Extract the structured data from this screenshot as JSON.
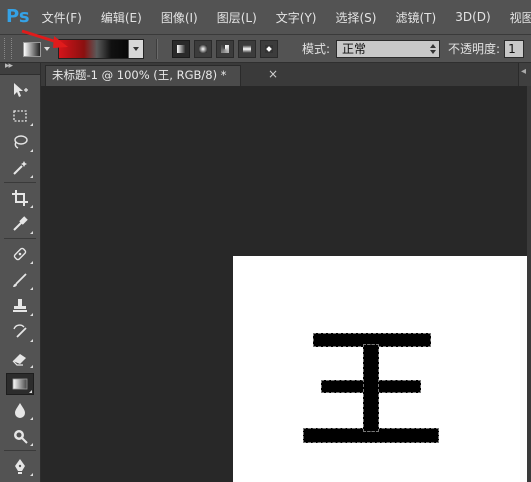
{
  "app": {
    "logo": "Ps"
  },
  "menu": [
    "文件(F)",
    "编辑(E)",
    "图像(I)",
    "图层(L)",
    "文字(Y)",
    "选择(S)",
    "滤镜(T)",
    "3D(D)",
    "视图("
  ],
  "options": {
    "gradient_colors": [
      "#d4141a",
      "#000000"
    ],
    "gradient_types": [
      "linear",
      "radial",
      "angle",
      "reflected",
      "diamond"
    ],
    "active_gradient_type": "linear",
    "mode_label": "模式:",
    "mode_value": "正常",
    "opacity_label": "不透明度:",
    "opacity_value": "1"
  },
  "document": {
    "tab_title": "未标题-1 @ 100% (王, RGB/8) *",
    "close_glyph": "×",
    "canvas_text": "王"
  },
  "toolbox": {
    "collapse_glyph": "▸▸",
    "active_tool": "gradient-tool"
  },
  "colors": {
    "ui_panel": "#535353",
    "workspace": "#282828",
    "accent_red": "#e01b1b",
    "ps_blue": "#35a2e6"
  }
}
